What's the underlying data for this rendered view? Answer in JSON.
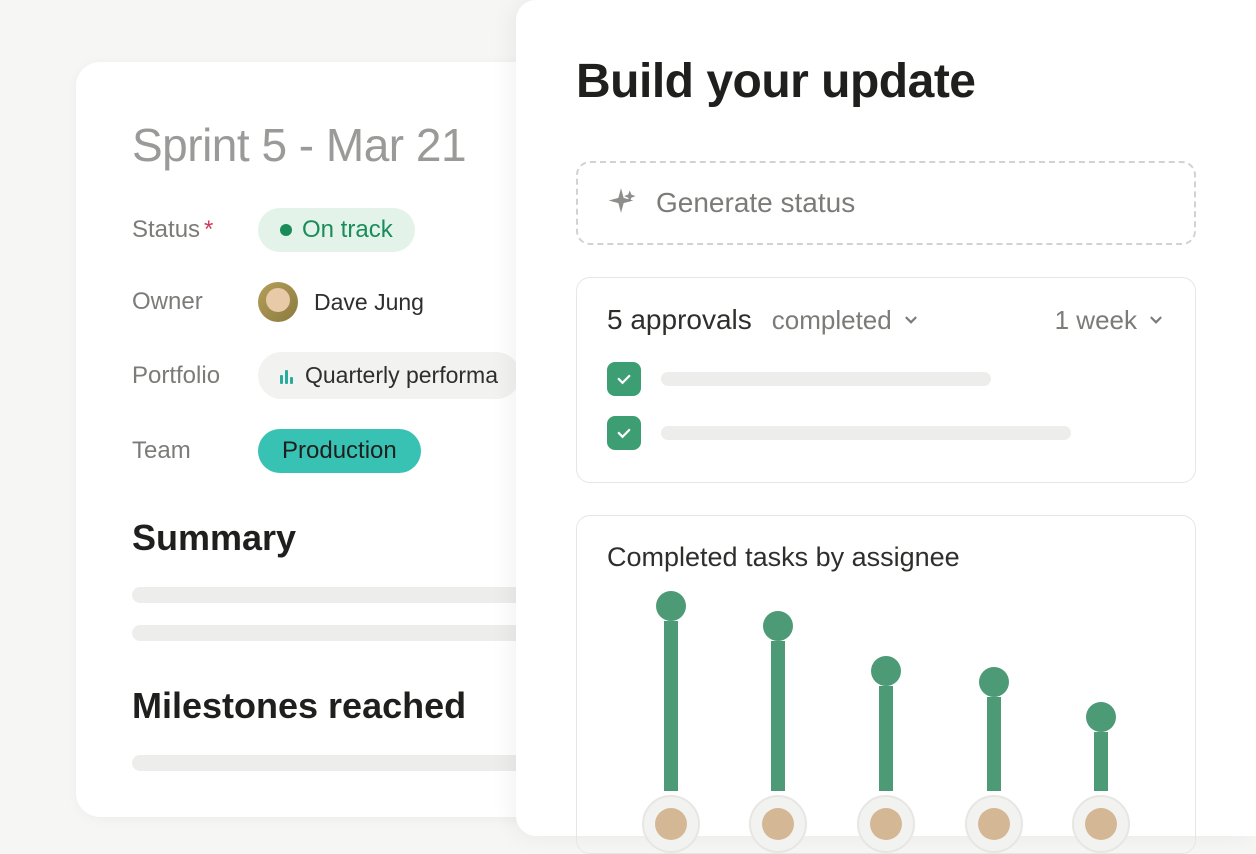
{
  "sprint": {
    "title": "Sprint 5 - Mar 21",
    "fields": {
      "status_label": "Status",
      "status_value": "On track",
      "owner_label": "Owner",
      "owner_value": "Dave Jung",
      "portfolio_label": "Portfolio",
      "portfolio_value": "Quarterly performa",
      "team_label": "Team",
      "team_value": "Production"
    },
    "sections": {
      "summary": "Summary",
      "milestones": "Milestones reached"
    }
  },
  "panel": {
    "title": "Build your update",
    "generate_label": "Generate status",
    "approvals": {
      "count_label": "5 approvals",
      "status_filter": "completed",
      "time_filter": "1 week"
    },
    "chart_title": "Completed tasks by assignee"
  },
  "chart_data": {
    "type": "bar",
    "title": "Completed tasks by assignee",
    "categories": [
      "assignee-1",
      "assignee-2",
      "assignee-3",
      "assignee-4",
      "assignee-5"
    ],
    "values": [
      100,
      88,
      62,
      55,
      35
    ],
    "note": "relative heights estimated from pixels; no numeric axis shown"
  },
  "colors": {
    "green": "#4c9b76",
    "teal": "#37c2b3",
    "status_green": "#1a8c5a"
  }
}
